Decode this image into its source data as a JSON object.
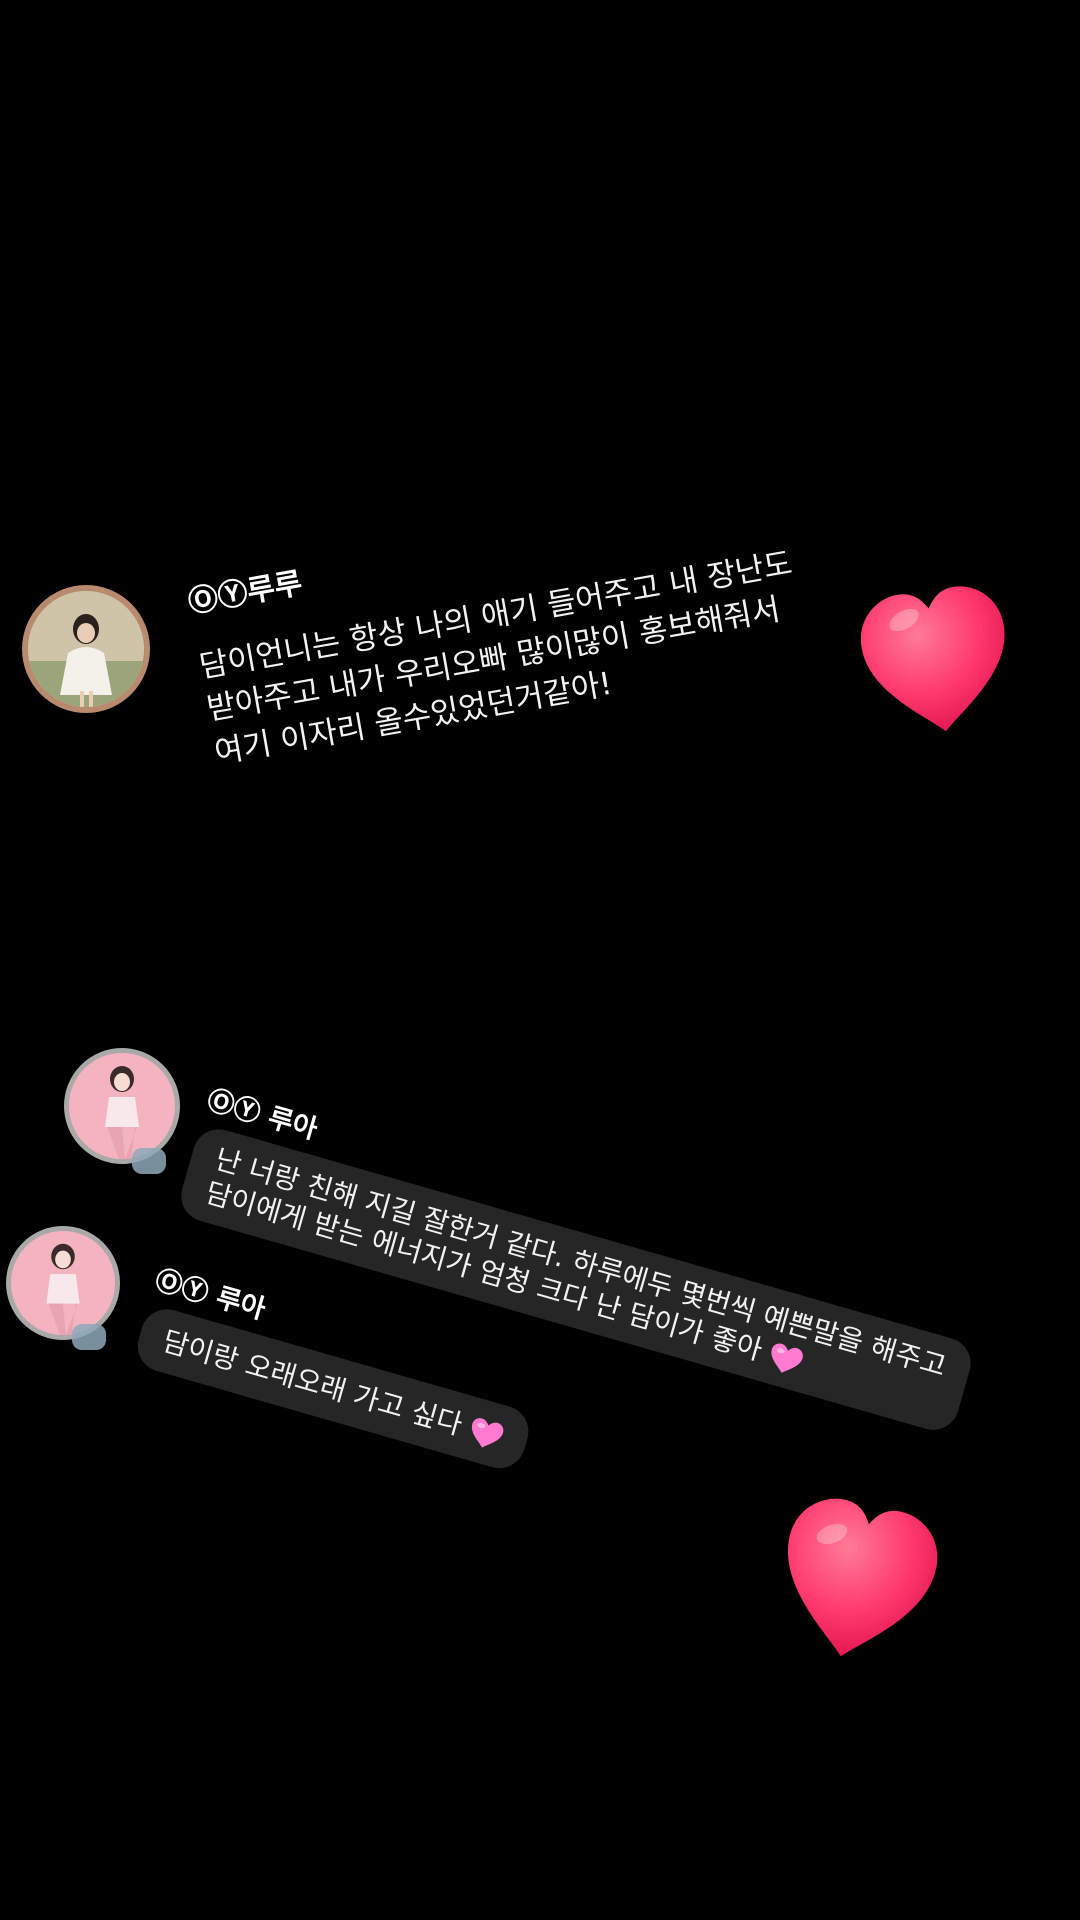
{
  "colors": {
    "background": "#000000",
    "bubble": "#262626",
    "text": "#f2f2f2",
    "heart": "#ff3a6e",
    "pink_heart": "#ff7ad0",
    "avatar_ring_1": "#b88a6e",
    "avatar_ring_2": "#a9a9a9"
  },
  "post1": {
    "username": "ⓄⓎ루루",
    "lines": [
      "담이언니는 항상 나의 애기 들어주고 내 장난도",
      "받아주고 내가 우리오빠 많이많이 홍보해줘서",
      "여기 이자리 올수있었던거같아!"
    ],
    "decoration": "red-heart-icon"
  },
  "post2": {
    "messages": [
      {
        "username": "ⓄⓎ 루아",
        "lines": [
          "난 너랑 친해 지길 잘한거 같다. 하루에두 몇번씩 예쁜말을 해주고",
          "담이에게 받는 에너지가 엄청 크다 난    담이가 좋아"
        ],
        "end_icon": "pink-heart-icon"
      },
      {
        "username": "ⓄⓎ 루아",
        "lines": [
          "담이랑 오래오래 가고 싶다"
        ],
        "end_icon": "pink-heart-icon"
      }
    ],
    "decoration": "red-heart-icon"
  }
}
